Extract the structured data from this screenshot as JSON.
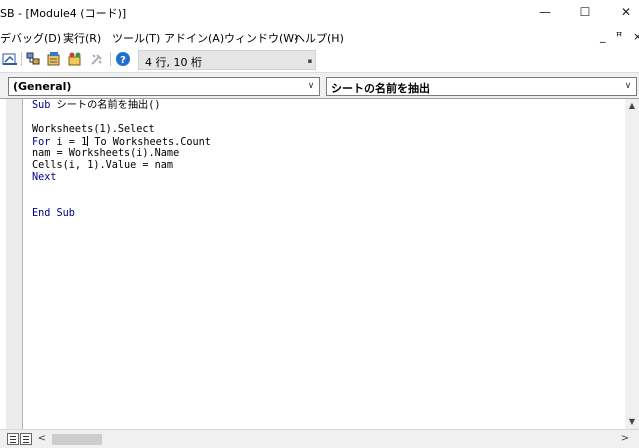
{
  "window": {
    "title": "SB - [Module4 (コード)]",
    "minimize_glyph": "—",
    "maximize_glyph": "☐",
    "close_glyph": "✕"
  },
  "menubar": {
    "items": [
      {
        "label": "デバッグ(D)"
      },
      {
        "label": "実行(R)"
      },
      {
        "label": "ツール(T)"
      },
      {
        "label": "アドイン(A)"
      },
      {
        "label": "ウィンドウ(W)"
      },
      {
        "label": "ヘルプ(H)"
      }
    ],
    "mdi_minimize": "_",
    "mdi_restore": "ꟸ",
    "mdi_close": "×"
  },
  "toolbar": {
    "icons": [
      "design-mode-icon",
      "project-explorer-icon",
      "properties-window-icon",
      "object-browser-icon",
      "toolbox-icon",
      "help-icon"
    ],
    "status": "4 行, 10 桁",
    "grip": "▪"
  },
  "combos": {
    "object": {
      "value": "(General)"
    },
    "procedure": {
      "value": "シートの名前を抽出"
    },
    "arrow": "∨"
  },
  "code": {
    "lines": [
      {
        "text": "Sub シートの名前を抽出()",
        "kw": "Sub"
      },
      {
        "text": ""
      },
      {
        "text": "Worksheets(1).Select"
      },
      {
        "text": "For i = 1 To Worksheets.Count",
        "kw": "For"
      },
      {
        "text": "nam = Worksheets(i).Name"
      },
      {
        "text": "Cells(i, 1).Value = nam"
      },
      {
        "text": "Next",
        "kw": "Next"
      },
      {
        "text": ""
      },
      {
        "text": ""
      },
      {
        "text": "End Sub",
        "kw": "End Sub"
      }
    ]
  },
  "scroll": {
    "up": "▲",
    "down": "▼",
    "left": "<",
    "right": ">"
  },
  "colors": {
    "keyword": "#00008b",
    "margin": "#ececec",
    "bar": "#f0f0f0"
  }
}
